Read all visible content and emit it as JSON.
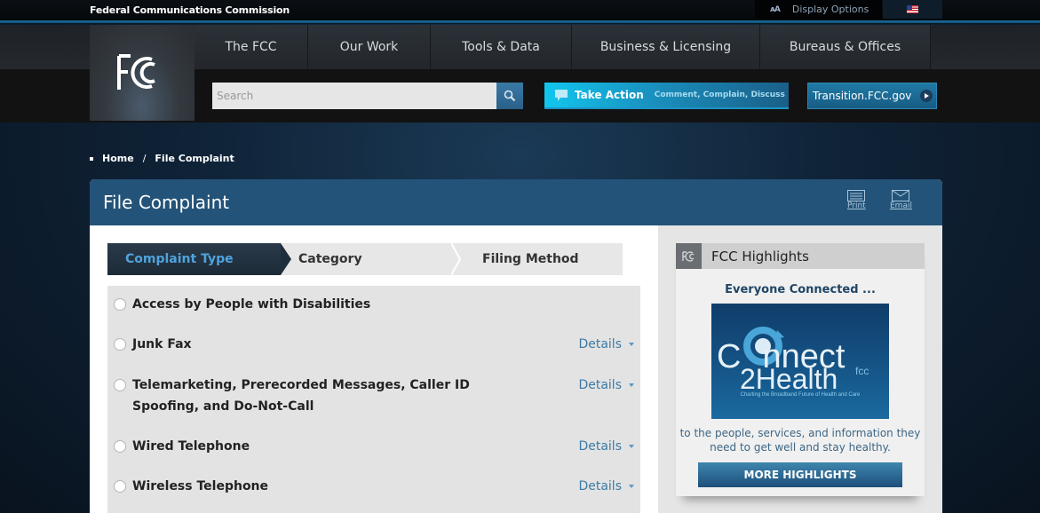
{
  "utility_bar": {
    "agency_name": "Federal Communications Commission",
    "display_options_icon": "text-size-icon",
    "display_options_label": "Display Options",
    "language_icon": "us-flag-icon"
  },
  "header": {
    "logo_text": "FCC",
    "nav": [
      {
        "label": "The FCC"
      },
      {
        "label": "Our Work"
      },
      {
        "label": "Tools & Data"
      },
      {
        "label": "Business & Licensing"
      },
      {
        "label": "Bureaus & Offices"
      }
    ],
    "search": {
      "placeholder": "Search",
      "value": "",
      "icon": "search-icon"
    },
    "take_action": {
      "label": "Take Action",
      "sublabel": "Comment, Complain, Discuss",
      "icon": "speech-bubble-icon"
    },
    "transition": {
      "label": "Transition.FCC.gov",
      "icon": "play-circle-icon"
    }
  },
  "breadcrumb": {
    "items": [
      {
        "label": "Home"
      },
      {
        "label": "File Complaint"
      }
    ],
    "separator": "/"
  },
  "page": {
    "title": "File Complaint",
    "tools": [
      {
        "label": "Print",
        "icon": "print-icon"
      },
      {
        "label": "Email",
        "icon": "email-icon"
      }
    ]
  },
  "steps": [
    {
      "label": "Complaint Type",
      "active": true
    },
    {
      "label": "Category",
      "active": false
    },
    {
      "label": "Filing Method",
      "active": false
    }
  ],
  "complaint_types": [
    {
      "label": "Access by People with Disabilities",
      "details": ""
    },
    {
      "label": "Junk Fax",
      "details": "Details"
    },
    {
      "label": "Telemarketing, Prerecorded Messages, Caller ID Spoofing, and Do-Not-Call",
      "details": "Details"
    },
    {
      "label": "Wired Telephone",
      "details": "Details"
    },
    {
      "label": "Wireless Telephone",
      "details": "Details"
    }
  ],
  "highlights": {
    "title": "FCC Highlights",
    "subtitle": "Everyone Connected ...",
    "promo": {
      "line1": "Connect",
      "line2": "2Health",
      "suffix": "fcc",
      "tagline": "Charting the Broadband Future of Health and Care"
    },
    "description": "to the people, services, and information they need to get well and stay healthy.",
    "more_button": "MORE HIGHLIGHTS"
  },
  "colors": {
    "header_blue": "#235378",
    "accent_cyan": "#12c6ee",
    "link_blue": "#3c7ba5",
    "active_step_text": "#4fa3dd"
  }
}
